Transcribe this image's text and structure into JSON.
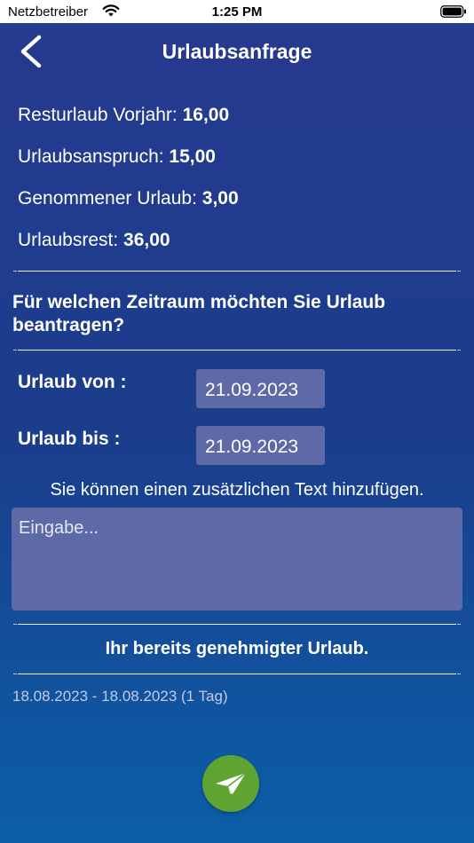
{
  "status_bar": {
    "carrier": "Netzbetreiber",
    "time": "1:25 PM"
  },
  "nav": {
    "title": "Urlaubsanfrage"
  },
  "stats": [
    {
      "label": "Resturlaub Vorjahr: ",
      "value": "16,00"
    },
    {
      "label": "Urlaubsanspruch: ",
      "value": "15,00"
    },
    {
      "label": "Genommener Urlaub: ",
      "value": "3,00"
    },
    {
      "label": "Urlaubsrest: ",
      "value": "36,00"
    }
  ],
  "form": {
    "question": "Für welchen Zeitraum möchten Sie Urlaub beantragen?",
    "from_label": "Urlaub von :",
    "from_value": "21.09.2023",
    "to_label": "Urlaub bis :",
    "to_value": "21.09.2023",
    "hint": "Sie können einen zusätzlichen Text hinzufügen.",
    "text_placeholder": "Eingabe..."
  },
  "approved": {
    "title": "Ihr bereits genehmigter Urlaub.",
    "items": [
      "18.08.2023 - 18.08.2023 (1 Tag)"
    ]
  },
  "colors": {
    "gradient_top": "#263a8f",
    "gradient_bottom": "#0b5fa8",
    "field_background": "#5e69a8",
    "send_button": "#5fa331"
  },
  "icons": {
    "back": "chevron-left-icon",
    "send": "paper-plane-icon",
    "wifi": "wifi-icon",
    "battery": "battery-icon"
  }
}
